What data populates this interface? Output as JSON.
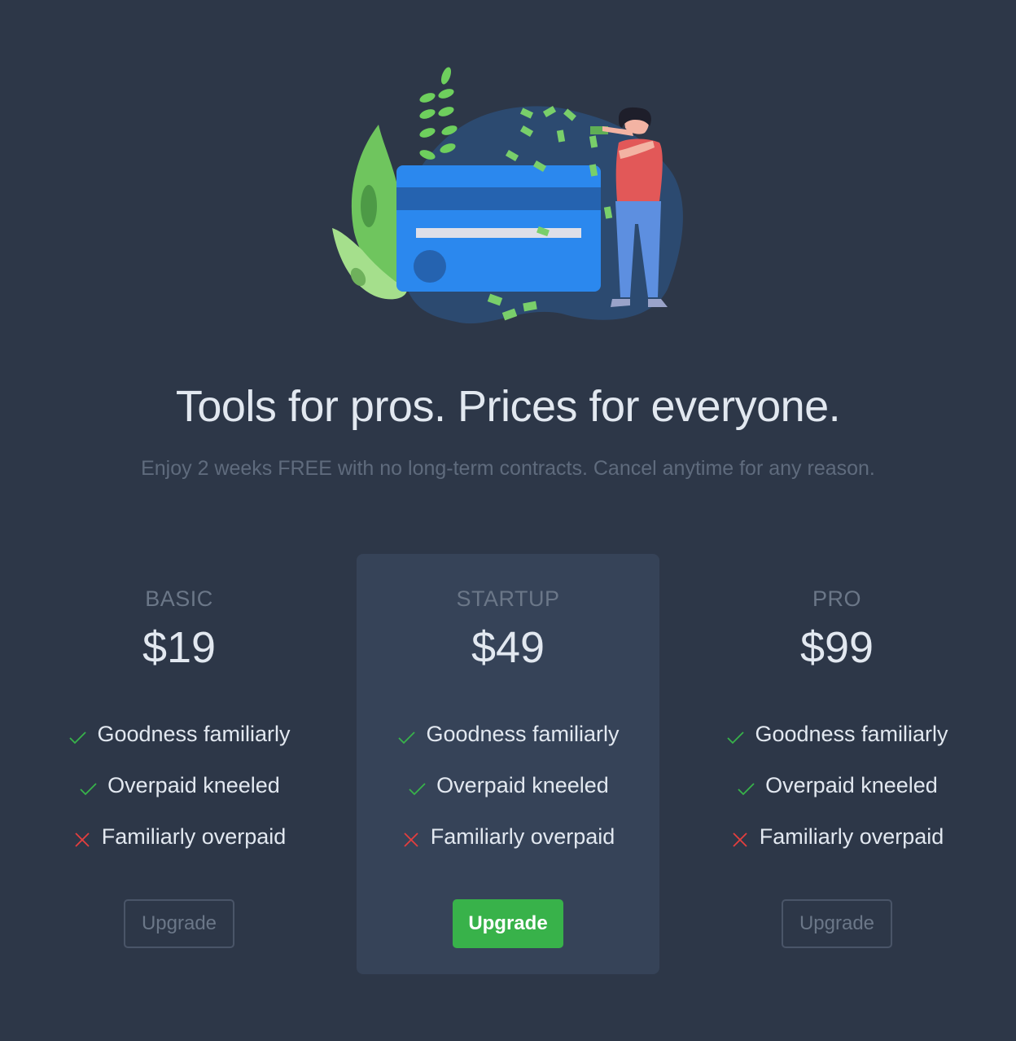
{
  "hero": {
    "illustration": "credit-card-money-illustration"
  },
  "headline": "Tools for pros. Prices for everyone.",
  "subline": "Enjoy 2 weeks FREE with no long-term contracts. Cancel anytime for any reason.",
  "colors": {
    "background": "#2d3748",
    "featured_card": "#364358",
    "check": "#38b24a",
    "cross": "#e53e3e",
    "primary_button": "#38b24a"
  },
  "plans": [
    {
      "name": "BASIC",
      "price": "$19",
      "features": [
        {
          "text": "Goodness familiarly",
          "included": true
        },
        {
          "text": "Overpaid kneeled",
          "included": true
        },
        {
          "text": "Familiarly overpaid",
          "included": false
        }
      ],
      "button": "Upgrade"
    },
    {
      "name": "STARTUP",
      "price": "$49",
      "features": [
        {
          "text": "Goodness familiarly",
          "included": true
        },
        {
          "text": "Overpaid kneeled",
          "included": true
        },
        {
          "text": "Familiarly overpaid",
          "included": false
        }
      ],
      "button": "Upgrade"
    },
    {
      "name": "PRO",
      "price": "$99",
      "features": [
        {
          "text": "Goodness familiarly",
          "included": true
        },
        {
          "text": "Overpaid kneeled",
          "included": true
        },
        {
          "text": "Familiarly overpaid",
          "included": false
        }
      ],
      "button": "Upgrade"
    }
  ]
}
